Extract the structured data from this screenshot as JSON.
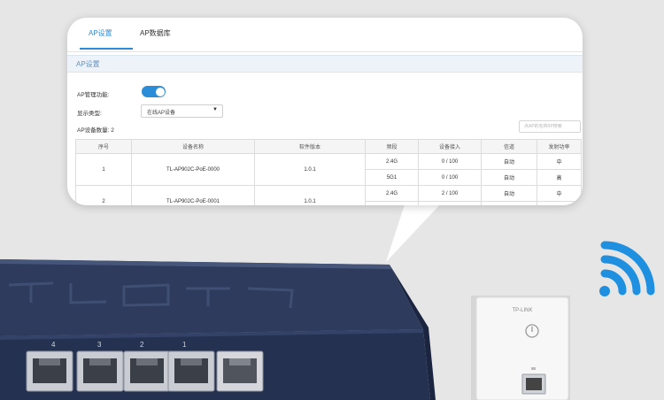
{
  "tabs": [
    {
      "label": "AP设置",
      "active": true
    },
    {
      "label": "AP数据库",
      "active": false
    }
  ],
  "section_title": "AP设置",
  "form": {
    "ap_manage_label": "AP管理功能:",
    "ap_manage_enabled": true,
    "display_type_label": "显示类型:",
    "display_type_value": "在线AP设备",
    "device_count_label": "AP设备数量: 2"
  },
  "search": {
    "placeholder": "点AP的名称/IP搜索"
  },
  "table": {
    "headers": [
      "序号",
      "设备名称",
      "软件版本",
      "频段",
      "设备接入",
      "信道",
      "发射功率"
    ],
    "rows": [
      {
        "index": "1",
        "name": "TL-AP902C-PoE-0000",
        "version": "1.0.1",
        "bands": [
          {
            "band": "2.4G",
            "clients": "0 / 100",
            "channel": "自动",
            "power": "中"
          },
          {
            "band": "5G1",
            "clients": "0 / 100",
            "channel": "自动",
            "power": "高"
          }
        ]
      },
      {
        "index": "2",
        "name": "TL-AP902C-PoE-0001",
        "version": "1.0.1",
        "bands": [
          {
            "band": "2.4G",
            "clients": "2 / 100",
            "channel": "自动",
            "power": "中"
          },
          {
            "band": "",
            "clients": "",
            "channel": "",
            "power": ""
          }
        ]
      }
    ]
  },
  "switch_ports": [
    "4",
    "3",
    "2",
    "1"
  ],
  "ap_brand": "TP-LINK",
  "colors": {
    "accent": "#2b8cd8",
    "wifi": "#1f8fe0",
    "switch_body": "#2e3b5c"
  },
  "icons": {
    "wifi": "wifi-icon",
    "power": "power-icon",
    "ethernet": "ethernet-port-icon"
  }
}
